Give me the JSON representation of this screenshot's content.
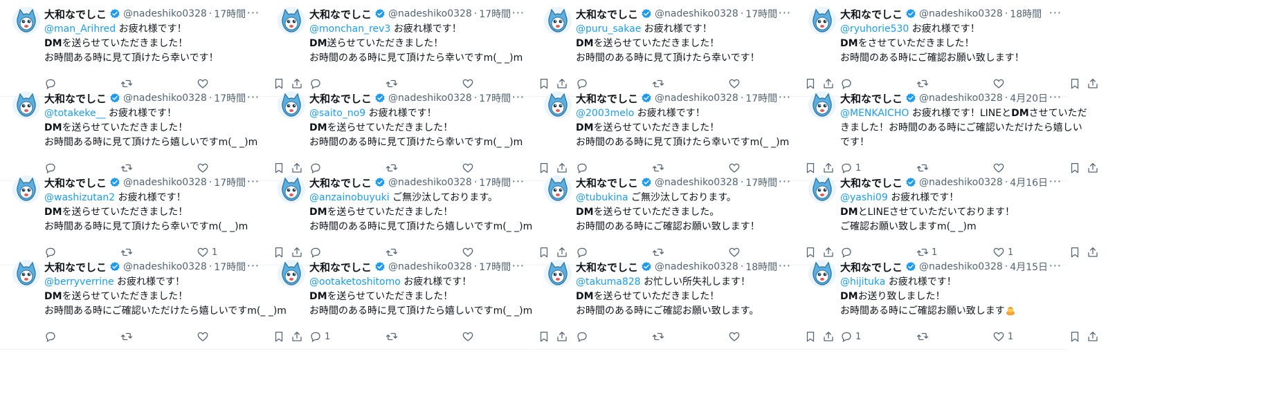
{
  "user": {
    "name": "大和なでしこ",
    "handle": "@nadeshiko0328"
  },
  "columns": [
    {
      "tweets": [
        {
          "time": "17時間",
          "mention": "@man_Arihred",
          "greeting": "お疲れ様です！",
          "lines": [
            [
              "DM",
              "を送らせていただきました！"
            ],
            [
              "",
              "お時間ある時に見て頂けたら幸いです！"
            ]
          ],
          "reply_count": "",
          "rt_count": "",
          "like_count": ""
        },
        {
          "time": "17時間",
          "mention": "@totakeke__",
          "greeting": "お疲れ様です！",
          "lines": [
            [
              "DM",
              "を送らせていただきました！"
            ],
            [
              "",
              "お時間ある時に見て頂けたら嬉しいですm(_ _)m"
            ]
          ],
          "reply_count": "",
          "rt_count": "",
          "like_count": ""
        },
        {
          "time": "17時間",
          "mention": "@washizutan2",
          "greeting": "お疲れ様です！",
          "lines": [
            [
              "DM",
              "を送らせていただきました！"
            ],
            [
              "",
              "お時間ある時に見て頂けたら幸いですm(_ _)m"
            ]
          ],
          "reply_count": "",
          "rt_count": "",
          "like_count": "1"
        },
        {
          "time": "17時間",
          "mention": "@berryverrine",
          "greeting": "お疲れ様です！",
          "lines": [
            [
              "DM",
              "を送らせていただきました！"
            ],
            [
              "",
              "お時間ある時にご確認いただけたら嬉しいですm(_ _)m"
            ]
          ],
          "reply_count": "",
          "rt_count": "",
          "like_count": ""
        }
      ]
    },
    {
      "tweets": [
        {
          "time": "17時間",
          "mention": "@monchan_rev3",
          "greeting": "お疲れ様です！",
          "lines": [
            [
              "DM",
              "送らせていただきました！"
            ],
            [
              "",
              "お時間のある時に見て頂けたら幸いですm(_ _)m"
            ]
          ],
          "reply_count": "",
          "rt_count": "",
          "like_count": ""
        },
        {
          "time": "17時間",
          "mention": "@saito_no9",
          "greeting": "お疲れ様です！",
          "lines": [
            [
              "DM",
              "を送らせていただきました！"
            ],
            [
              "",
              "お時間のある時に見て頂けたら幸いですm(_ _)m"
            ]
          ],
          "reply_count": "",
          "rt_count": "",
          "like_count": ""
        },
        {
          "time": "17時間",
          "mention": "@anzainobuyuki",
          "greeting": "ご無沙汰しております。",
          "lines": [
            [
              "DM",
              "を送らせていただきました！"
            ],
            [
              "",
              "お時間のある時に見て頂けたら嬉しいですm(_ _)m"
            ]
          ],
          "reply_count": "",
          "rt_count": "",
          "like_count": ""
        },
        {
          "time": "17時間",
          "mention": "@ootaketoshitomo",
          "greeting": "お疲れ様です！",
          "lines": [
            [
              "DM",
              "を送らせていただきました！"
            ],
            [
              "",
              "お時間のある時に見て頂けたら嬉しいですm(_ _)m"
            ]
          ],
          "reply_count": "1",
          "rt_count": "",
          "like_count": ""
        }
      ]
    },
    {
      "tweets": [
        {
          "time": "17時間",
          "mention": "@puru_sakae",
          "greeting": "お疲れ様です！",
          "lines": [
            [
              "DM",
              "を送らせていただきました！"
            ],
            [
              "",
              "お時間のある時に見て頂けたら幸いです！"
            ]
          ],
          "reply_count": "",
          "rt_count": "",
          "like_count": ""
        },
        {
          "time": "17時間",
          "mention": "@2003melo",
          "greeting": "お疲れ様です！",
          "lines": [
            [
              "DM",
              "を送らせていただきました！"
            ],
            [
              "",
              "お時間のある時に見て頂けたら幸いですm(_ _)m"
            ]
          ],
          "reply_count": "",
          "rt_count": "",
          "like_count": ""
        },
        {
          "time": "17時間",
          "mention": "@tubukina",
          "greeting": "ご無沙汰しております。",
          "lines": [
            [
              "DM",
              "を送らせていただきました。"
            ],
            [
              "",
              "お時間のある時にご確認お願い致します！"
            ]
          ],
          "reply_count": "",
          "rt_count": "",
          "like_count": ""
        },
        {
          "time": "18時間",
          "mention": "@takuma828",
          "greeting": "お忙しい所失礼します！",
          "lines": [
            [
              "DM",
              "を送らせていただきました！"
            ],
            [
              "",
              "お時間のある時にご確認お願い致します。"
            ]
          ],
          "reply_count": "",
          "rt_count": "",
          "like_count": ""
        }
      ]
    },
    {
      "tweets": [
        {
          "time": "18時間",
          "mention": "@ryuhorie530",
          "greeting": "お疲れ様です！",
          "lines": [
            [
              "DM",
              "をさせていただきました！"
            ],
            [
              "",
              "お時間のある時にご確認お願い致します！"
            ]
          ],
          "reply_count": "",
          "rt_count": "",
          "like_count": ""
        },
        {
          "time": "4月20日",
          "mention": "@MENKAICHO",
          "greeting": "お疲れ様です！LINEと",
          "after_dm": "させていただ",
          "lines": [
            [
              "",
              "きました！お時間のある時にご確認いただけたら嬉しい"
            ],
            [
              "",
              "です！"
            ]
          ],
          "reply_count": "1",
          "rt_count": "",
          "like_count": ""
        },
        {
          "time": "4月16日",
          "mention": "@yashi09",
          "greeting": "お疲れ様です！",
          "lines": [
            [
              "DM",
              "とLINEさせていただいております！"
            ],
            [
              "",
              "ご確認お願い致しますm(_ _)m"
            ]
          ],
          "reply_count": "",
          "rt_count": "1",
          "like_count": "1"
        },
        {
          "time": "4月15日",
          "mention": "@hijituka",
          "greeting": "お疲れ様です！",
          "lines": [
            [
              "DM",
              "お送り致しました！"
            ],
            [
              "",
              "お時間ある時にご確認お願い致します"
            ]
          ],
          "emoji": "bowing-person-emoji",
          "reply_count": "1",
          "rt_count": "",
          "like_count": "1"
        }
      ]
    }
  ],
  "dm_word": "DM",
  "colors": {
    "mention": "#1d9bf0",
    "verified": "#1d9bf0",
    "muted": "#536471",
    "avatar_bg": "#5aaee0"
  }
}
